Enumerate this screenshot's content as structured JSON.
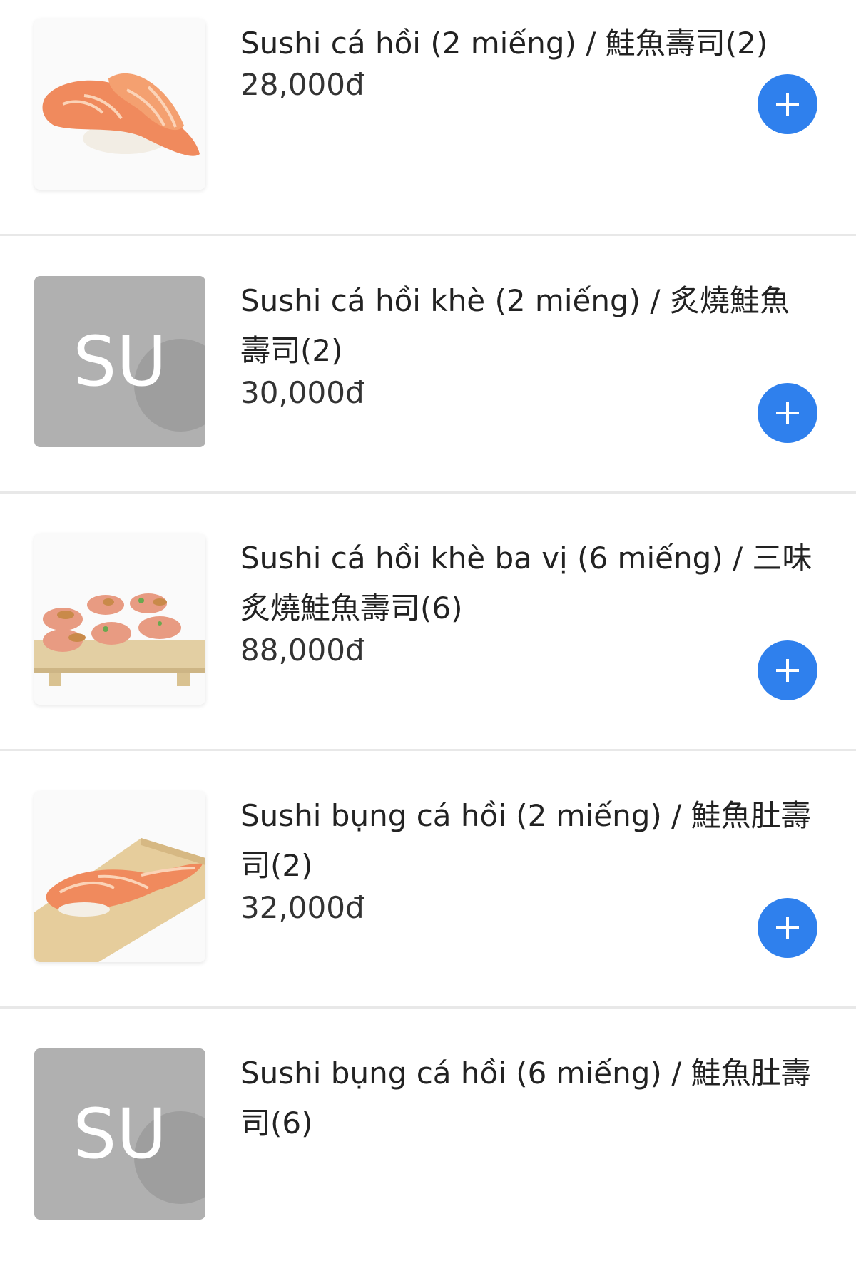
{
  "menu": {
    "items": [
      {
        "name": "Sushi cá hồi (2 miếng) / 鮭魚壽司(2)",
        "price": "28,000đ",
        "image": "salmon-nigiri-photo",
        "add_icon": "plus-icon"
      },
      {
        "name": "Sushi cá hồi khè (2 miếng) / 炙燒鮭魚壽司(2)",
        "price": "30,000đ",
        "image": "placeholder",
        "placeholder_text": "SU",
        "add_icon": "plus-icon"
      },
      {
        "name": "Sushi cá hồi khè ba vị (6 miếng) / 三味炙燒鮭魚壽司(6)",
        "price": "88,000đ",
        "image": "seared-salmon-platter-photo",
        "add_icon": "plus-icon"
      },
      {
        "name": "Sushi bụng cá hồi (2 miếng) / 鮭魚肚壽司(2)",
        "price": "32,000đ",
        "image": "salmon-belly-nigiri-photo",
        "add_icon": "plus-icon"
      },
      {
        "name": "Sushi bụng cá hồi (6 miếng) / 鮭魚肚壽司(6)",
        "image": "placeholder",
        "placeholder_text": "SU"
      }
    ]
  },
  "colors": {
    "accent": "#2f80ed",
    "placeholder": "#b0b0b0",
    "divider": "#e8e8e8",
    "text": "#222222"
  }
}
